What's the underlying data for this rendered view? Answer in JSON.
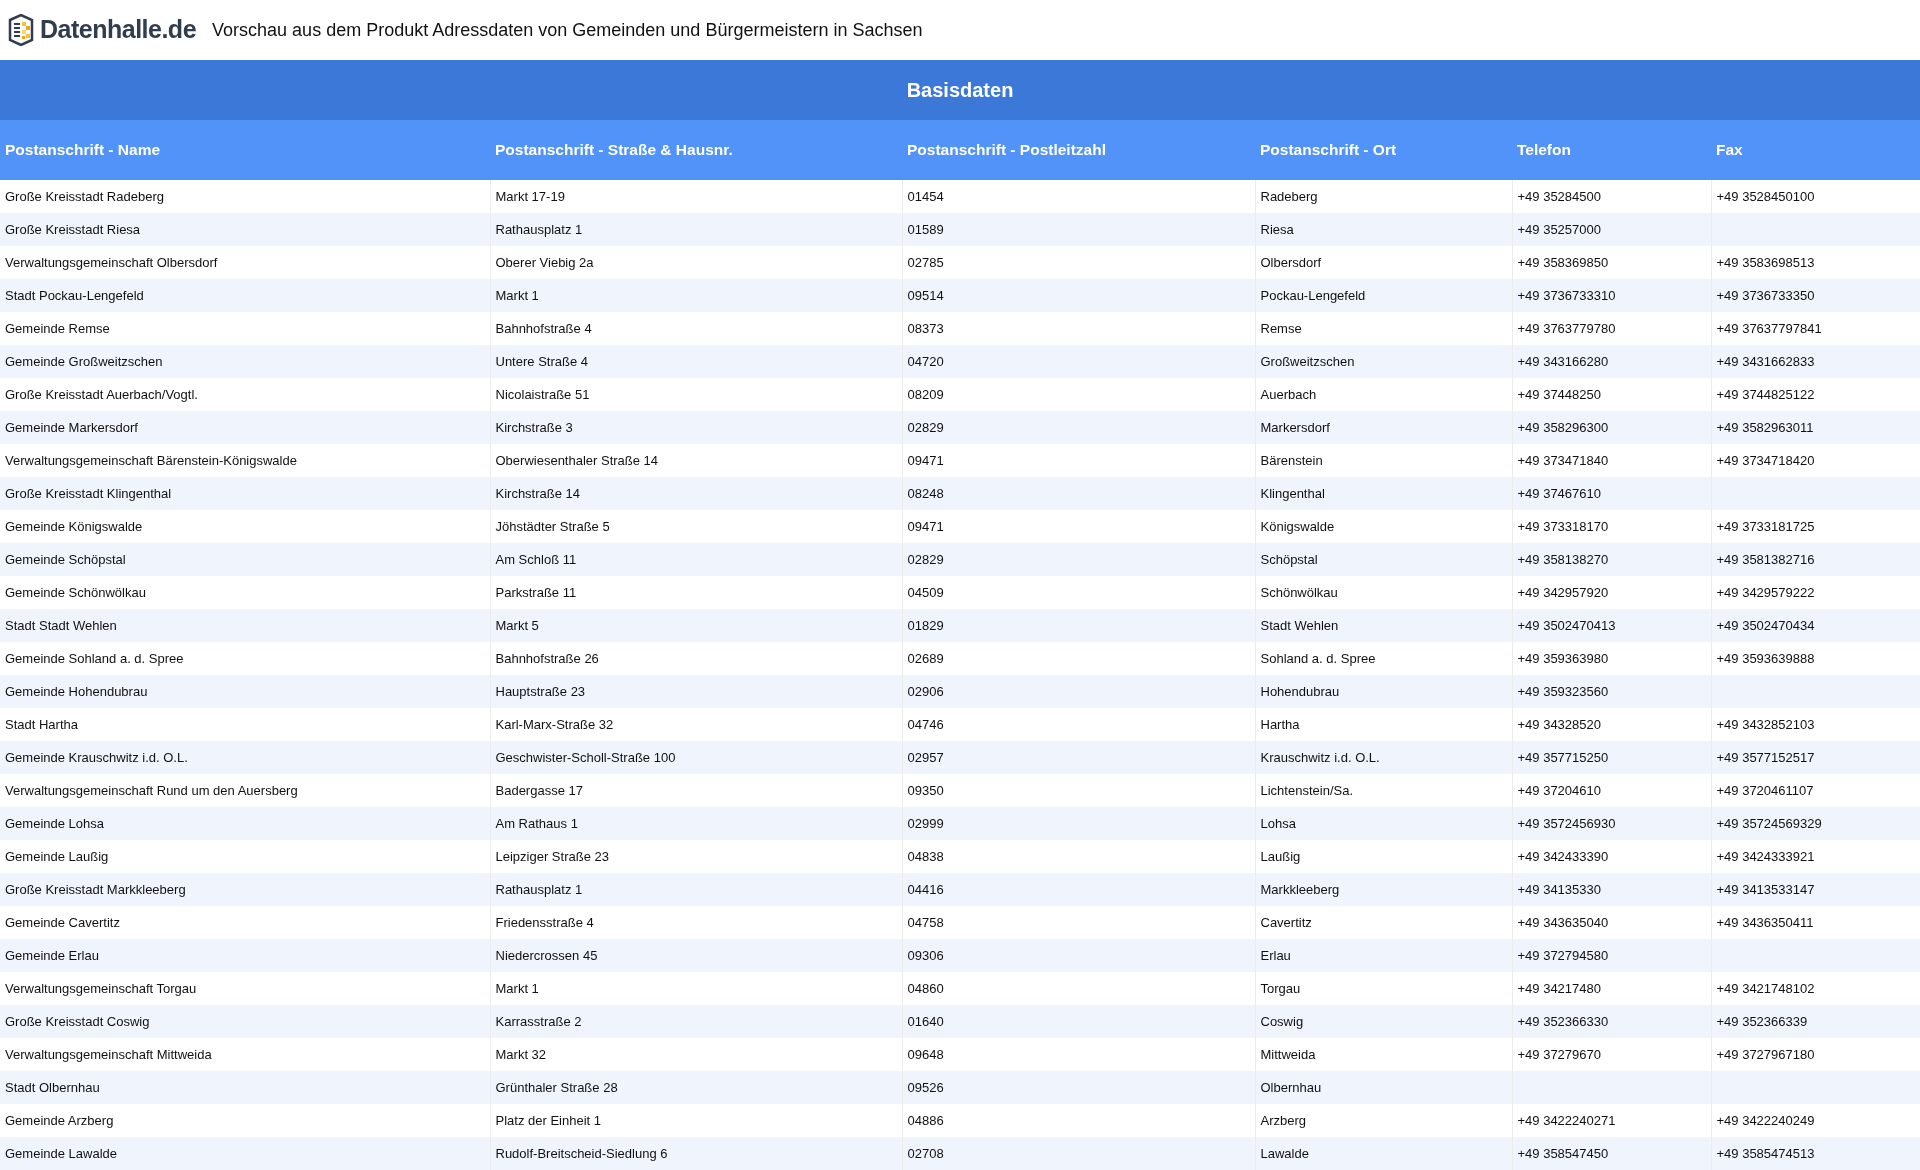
{
  "header": {
    "logo_text": "Datenhalle.de",
    "title": "Vorschau aus dem Produkt Adressdaten von Gemeinden und Bürgermeistern in Sachsen"
  },
  "table": {
    "group_title": "Basisdaten",
    "columns": [
      "Postanschrift - Name",
      "Postanschrift - Straße & Hausnr.",
      "Postanschrift - Postleitzahl",
      "Postanschrift - Ort",
      "Telefon",
      "Fax"
    ],
    "rows": [
      {
        "name": "Große Kreisstadt Radeberg",
        "street": "Markt 17-19",
        "zip": "01454",
        "city": "Radeberg",
        "phone": "+49 35284500",
        "fax": "+49 3528450100"
      },
      {
        "name": "Große Kreisstadt Riesa",
        "street": "Rathausplatz 1",
        "zip": "01589",
        "city": "Riesa",
        "phone": "+49 35257000"
      },
      {
        "name": "Verwaltungsgemeinschaft Olbersdorf",
        "street": "Oberer Viebig 2a",
        "zip": "02785",
        "city": "Olbersdorf",
        "phone": "+49 358369850",
        "fax": "+49 3583698513"
      },
      {
        "name": "Stadt Pockau-Lengefeld",
        "street": "Markt 1",
        "zip": "09514",
        "city": "Pockau-Lengefeld",
        "phone": "+49 3736733310",
        "fax": "+49 3736733350"
      },
      {
        "name": "Gemeinde Remse",
        "street": "Bahnhofstraße 4",
        "zip": "08373",
        "city": "Remse",
        "phone": "+49 3763779780",
        "fax": "+49 37637797841"
      },
      {
        "name": "Gemeinde Großweitzschen",
        "street": "Untere Straße 4",
        "zip": "04720",
        "city": "Großweitzschen",
        "phone": "+49 343166280",
        "fax": "+49 3431662833"
      },
      {
        "name": "Große Kreisstadt Auerbach/Vogtl.",
        "street": "Nicolaistraße 51",
        "zip": "08209",
        "city": "Auerbach",
        "phone": "+49 37448250",
        "fax": "+49 3744825122"
      },
      {
        "name": "Gemeinde Markersdorf",
        "street": "Kirchstraße 3",
        "zip": "02829",
        "city": "Markersdorf",
        "phone": "+49 358296300",
        "fax": "+49 3582963011"
      },
      {
        "name": "Verwaltungsgemeinschaft Bärenstein-Königswalde",
        "street": "Oberwiesenthaler Straße 14",
        "zip": "09471",
        "city": "Bärenstein",
        "phone": "+49 373471840",
        "fax": "+49 3734718420"
      },
      {
        "name": "Große Kreisstadt Klingenthal",
        "street": "Kirchstraße 14",
        "zip": "08248",
        "city": "Klingenthal",
        "phone": "+49 37467610"
      },
      {
        "name": "Gemeinde Königswalde",
        "street": "Jöhstädter Straße 5",
        "zip": "09471",
        "city": "Königswalde",
        "phone": "+49 373318170",
        "fax": "+49 3733181725"
      },
      {
        "name": "Gemeinde Schöpstal",
        "street": "Am Schloß 11",
        "zip": "02829",
        "city": "Schöpstal",
        "phone": "+49 358138270",
        "fax": "+49 3581382716"
      },
      {
        "name": "Gemeinde Schönwölkau",
        "street": "Parkstraße 11",
        "zip": "04509",
        "city": "Schönwölkau",
        "phone": "+49 342957920",
        "fax": "+49 3429579222"
      },
      {
        "name": "Stadt Stadt Wehlen",
        "street": "Markt 5",
        "zip": "01829",
        "city": "Stadt Wehlen",
        "phone": "+49 3502470413",
        "fax": "+49 3502470434"
      },
      {
        "name": "Gemeinde Sohland a. d. Spree",
        "street": "Bahnhofstraße 26",
        "zip": "02689",
        "city": "Sohland a. d. Spree",
        "phone": "+49 359363980",
        "fax": "+49 3593639888"
      },
      {
        "name": "Gemeinde Hohendubrau",
        "street": "Hauptstraße 23",
        "zip": "02906",
        "city": "Hohendubrau",
        "phone": "+49 359323560"
      },
      {
        "name": "Stadt Hartha",
        "street": "Karl-Marx-Straße 32",
        "zip": "04746",
        "city": "Hartha",
        "phone": "+49 34328520",
        "fax": "+49 3432852103"
      },
      {
        "name": "Gemeinde Krauschwitz i.d. O.L.",
        "street": "Geschwister-Scholl-Straße 100",
        "zip": "02957",
        "city": "Krauschwitz i.d. O.L.",
        "phone": "+49 357715250",
        "fax": "+49 3577152517"
      },
      {
        "name": "Verwaltungsgemeinschaft Rund um den Auersberg",
        "street": "Badergasse 17",
        "zip": "09350",
        "city": "Lichtenstein/Sa.",
        "phone": "+49 37204610",
        "fax": "+49 3720461107"
      },
      {
        "name": "Gemeinde Lohsa",
        "street": "Am Rathaus 1",
        "zip": "02999",
        "city": "Lohsa",
        "phone": "+49 3572456930",
        "fax": "+49 35724569329"
      },
      {
        "name": "Gemeinde Laußig",
        "street": "Leipziger Straße 23",
        "zip": "04838",
        "city": "Laußig",
        "phone": "+49 342433390",
        "fax": "+49 3424333921"
      },
      {
        "name": "Große Kreisstadt Markkleeberg",
        "street": "Rathausplatz 1",
        "zip": "04416",
        "city": "Markkleeberg",
        "phone": "+49 34135330",
        "fax": "+49 3413533147"
      },
      {
        "name": "Gemeinde Cavertitz",
        "street": "Friedensstraße 4",
        "zip": "04758",
        "city": "Cavertitz",
        "phone": "+49 343635040",
        "fax": "+49 3436350411"
      },
      {
        "name": "Gemeinde Erlau",
        "street": "Niedercrossen 45",
        "zip": "09306",
        "city": "Erlau",
        "phone": "+49 372794580"
      },
      {
        "name": "Verwaltungsgemeinschaft Torgau",
        "street": "Markt 1",
        "zip": "04860",
        "city": "Torgau",
        "phone": "+49 34217480",
        "fax": "+49 3421748102"
      },
      {
        "name": "Große Kreisstadt Coswig",
        "street": "Karrasstraße 2",
        "zip": "01640",
        "city": "Coswig",
        "phone": "+49 352366330",
        "fax": "+49 352366339"
      },
      {
        "name": "Verwaltungsgemeinschaft Mittweida",
        "street": "Markt 32",
        "zip": "09648",
        "city": "Mittweida",
        "phone": "+49 37279670",
        "fax": "+49 3727967180"
      },
      {
        "name": "Stadt Olbernhau",
        "street": "Grünthaler Straße 28",
        "zip": "09526",
        "city": "Olbernhau"
      },
      {
        "name": "Gemeinde Arzberg",
        "street": "Platz der Einheit 1",
        "zip": "04886",
        "city": "Arzberg",
        "phone": "+49 3422240271",
        "fax": "+49 3422240249"
      },
      {
        "name": "Gemeinde Lawalde",
        "street": "Rudolf-Breitscheid-Siedlung 6",
        "zip": "02708",
        "city": "Lawalde",
        "phone": "+49 358547450",
        "fax": "+49 3585474513"
      }
    ]
  }
}
